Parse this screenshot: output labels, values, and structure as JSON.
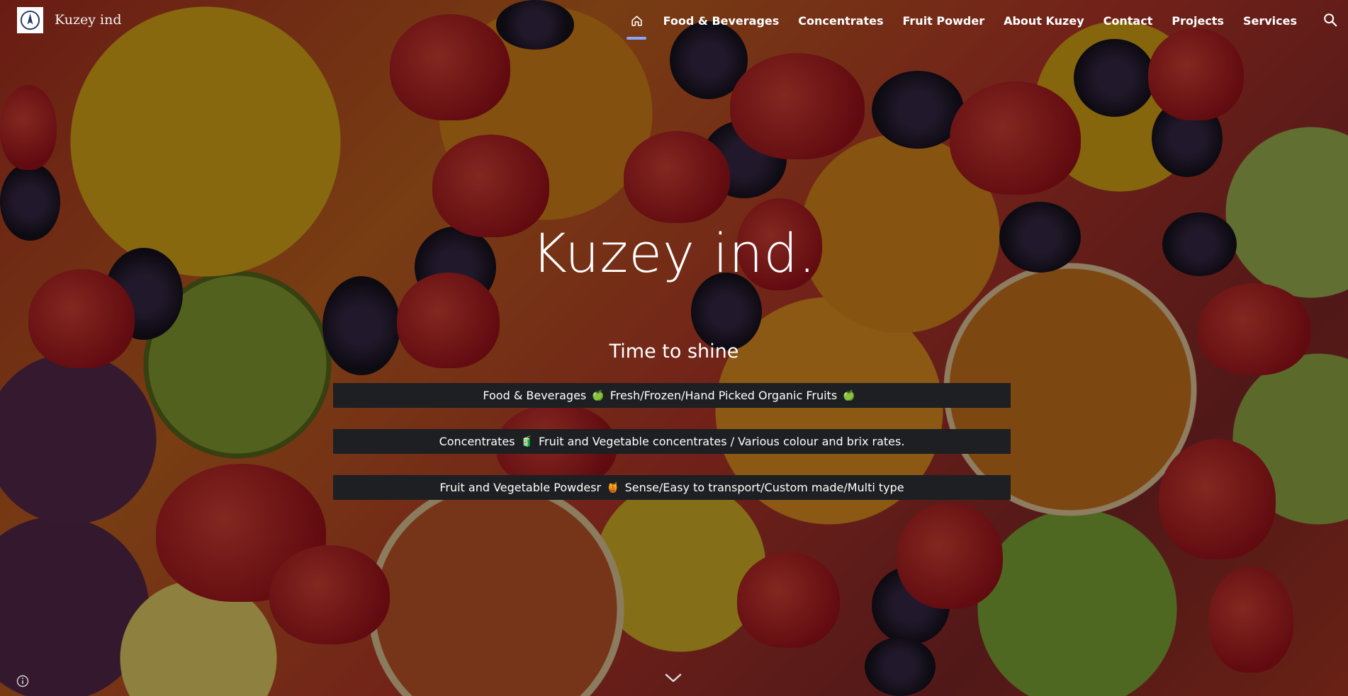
{
  "site": {
    "title": "Kuzey ind",
    "logo": "compass-logo-icon"
  },
  "nav": {
    "home_icon": "home-icon",
    "active": "home",
    "items": [
      "Food & Beverages",
      "Concentrates",
      "Fruit Powder",
      "About Kuzey",
      "Contact",
      "Projects",
      "Services"
    ],
    "search_icon": "search-icon"
  },
  "hero": {
    "title": "Kuzey ind.",
    "subtitle": "Time to shine",
    "banners": [
      {
        "lead": "Food & Beverages",
        "icon": "🍏",
        "text": "Fresh/Frozen/Hand Picked Organic Fruits",
        "trail_icon": "🍏"
      },
      {
        "lead": "Concentrates",
        "icon": "🧃",
        "text": "Fruit and Vegetable concentrates / Various colour and brix rates.",
        "trail_icon": ""
      },
      {
        "lead": "Fruit and Vegetable Powdesr",
        "icon": "🍯",
        "text": "Sense/Easy to transport/Custom made/Multi type",
        "trail_icon": ""
      }
    ],
    "scroll_icon": "chevron-down-icon"
  },
  "footer": {
    "info_icon": "info-icon"
  },
  "colors": {
    "nav_active_underline": "#8aa6ff",
    "banner_bg": "#1e1f22",
    "text": "#ffffff"
  }
}
